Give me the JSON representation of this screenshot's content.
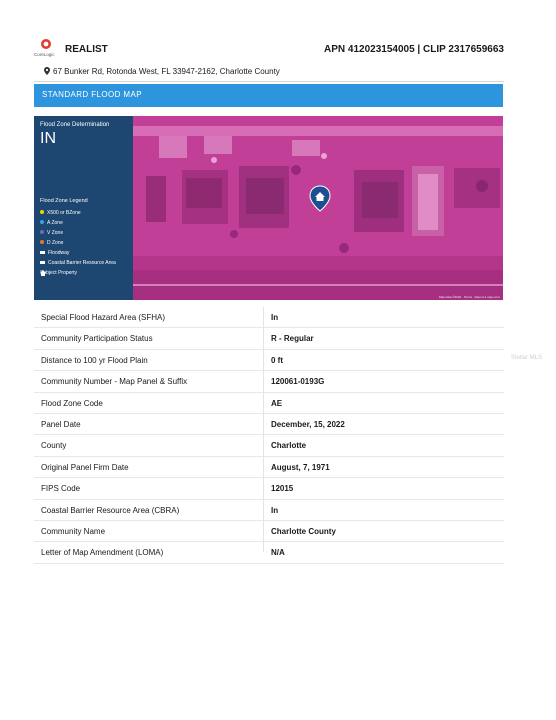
{
  "header": {
    "logo_text": "CoreLogic",
    "brand": "REALIST",
    "apn": "APN 412023154005 | CLIP 2317659663"
  },
  "address": "67 Bunker Rd, Rotonda West, FL 33947-2162, Charlotte County",
  "banner": "STANDARD FLOOD MAP",
  "map": {
    "zone_determination_label": "Flood Zone Determination",
    "zone_determination_value": "IN",
    "legend_title": "Flood Zone Legend",
    "legend": [
      {
        "label": "X500 or BZone",
        "color": "#f2d400",
        "shape": "dot"
      },
      {
        "label": "A Zone",
        "color": "#3aa0e8",
        "shape": "dot"
      },
      {
        "label": "V Zone",
        "color": "#7b61c9",
        "shape": "dot"
      },
      {
        "label": "D Zone",
        "color": "#e5782b",
        "shape": "dot"
      },
      {
        "label": "Floodway",
        "color": "#ffffff",
        "shape": "square"
      },
      {
        "label": "Coastal Barrier Resource Area",
        "color": "#ffffff",
        "shape": "square"
      },
      {
        "label": "Subject Property",
        "icon": "home-pin-icon",
        "shape": "icon"
      }
    ],
    "attribution": "Map data ©2022 · Terms · Report a map error"
  },
  "rows": [
    {
      "label": "Special Flood Hazard Area (SFHA)",
      "value": "In"
    },
    {
      "label": "Community Participation Status",
      "value": "R - Regular"
    },
    {
      "label": "Distance to 100 yr Flood Plain",
      "value": "0 ft"
    },
    {
      "label": "Community Number - Map Panel & Suffix",
      "value": "120061-0193G"
    },
    {
      "label": "Flood Zone Code",
      "value": "AE"
    },
    {
      "label": "Panel Date",
      "value": "December, 15, 2022"
    },
    {
      "label": "County",
      "value": "Charlotte"
    },
    {
      "label": "Original Panel Firm Date",
      "value": "August, 7, 1971"
    },
    {
      "label": "FIPS Code",
      "value": "12015"
    },
    {
      "label": "Coastal Barrier Resource Area (CBRA)",
      "value": "In"
    },
    {
      "label": "Community Name",
      "value": "Charlotte County"
    },
    {
      "label": "Letter of Map Amendment (LOMA)",
      "value": "N/A"
    }
  ],
  "watermark": "Stellar MLS",
  "colors": {
    "banner": "#2d95dd",
    "legend_panel": "#1d4670",
    "flood_overlay": "#c4419a"
  }
}
